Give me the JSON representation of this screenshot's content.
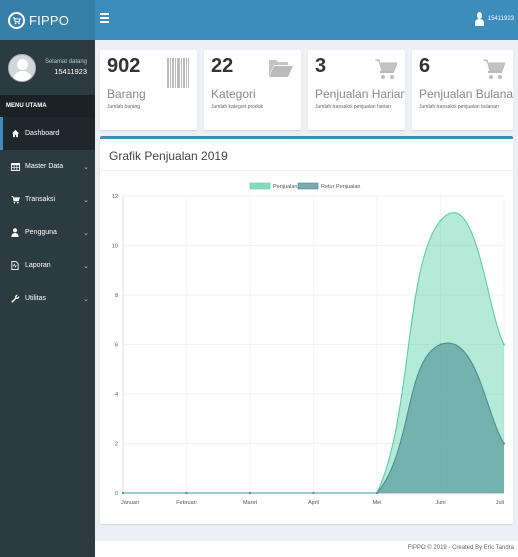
{
  "app": {
    "logo_text": "FIPPO"
  },
  "user": {
    "greeting": "Selamat datang",
    "name": "15411923",
    "top_name": "15411923"
  },
  "sidebar": {
    "header": "MENU UTAMA",
    "items": [
      {
        "label": "Dashboard",
        "icon": "home-icon",
        "has_submenu": false,
        "active": true
      },
      {
        "label": "Master Data",
        "icon": "table-icon",
        "has_submenu": true,
        "active": false
      },
      {
        "label": "Transaksi",
        "icon": "cart-icon",
        "has_submenu": true,
        "active": false
      },
      {
        "label": "Pengguna",
        "icon": "user-icon",
        "has_submenu": true,
        "active": false
      },
      {
        "label": "Laporan",
        "icon": "file-icon",
        "has_submenu": true,
        "active": false
      },
      {
        "label": "Utilitas",
        "icon": "wrench-icon",
        "has_submenu": true,
        "active": false
      }
    ]
  },
  "stats": [
    {
      "value": "902",
      "label": "Barang",
      "sub": "Jumlah barang",
      "icon": "barcode-icon"
    },
    {
      "value": "22",
      "label": "Kategori",
      "sub": "Jumlah kategori produk",
      "icon": "folder-open-icon"
    },
    {
      "value": "3",
      "label": "Penjualan Harian",
      "sub": "Jumlah transaksi penjualan harian",
      "icon": "shopping-cart-icon"
    },
    {
      "value": "6",
      "label": "Penjualan Bulanan",
      "sub": "Jumlah transaksi penjualan bulanan",
      "icon": "shopping-cart-icon"
    }
  ],
  "colors": {
    "primary": "#3c8dbc",
    "sidebar": "#2c3b41",
    "series_penjualan": "#5ccfa8",
    "series_retur": "#4a8f91"
  },
  "chart_data": {
    "type": "area",
    "title": "Grafik Penjualan 2019",
    "categories": [
      "Januari",
      "Februari",
      "Maret",
      "April",
      "Mei",
      "Juni",
      "Juli"
    ],
    "series": [
      {
        "name": "Penjualan",
        "values": [
          0,
          0,
          0,
          0,
          0,
          11,
          6
        ]
      },
      {
        "name": "Retur Penjualan",
        "values": [
          0,
          0,
          0,
          0,
          0,
          6,
          2
        ]
      }
    ],
    "ylim": [
      0,
      12
    ],
    "yticks": [
      0,
      2,
      4,
      6,
      8,
      10,
      12
    ],
    "legend": "top-center",
    "grid": true
  },
  "footer": {
    "text": "FIPPO © 2019 - Created By Eric Tandra"
  }
}
